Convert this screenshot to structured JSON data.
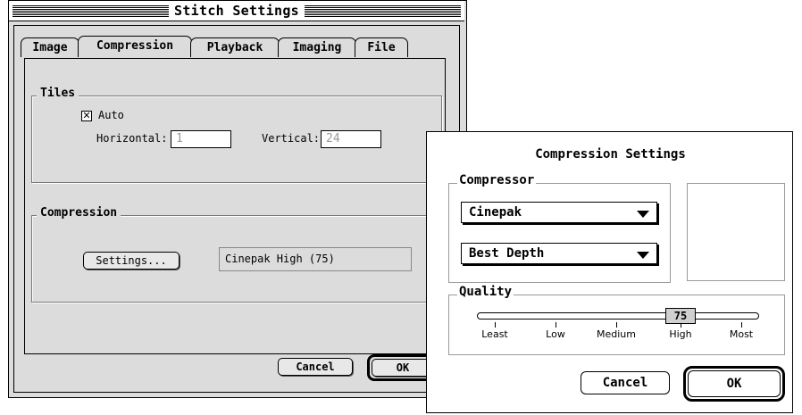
{
  "stitch": {
    "title": "Stitch Settings",
    "tabs": [
      {
        "label": "Image"
      },
      {
        "label": "Compression"
      },
      {
        "label": "Playback"
      },
      {
        "label": "Imaging"
      },
      {
        "label": "File"
      }
    ],
    "active_tab": "Compression",
    "tiles": {
      "label": "Tiles",
      "auto_label": "Auto",
      "auto_checked": true,
      "horizontal_label": "Horizontal:",
      "horizontal_value": "1",
      "vertical_label": "Vertical:",
      "vertical_value": "24"
    },
    "compression": {
      "label": "Compression",
      "settings_button": "Settings...",
      "current_value": "Cinepak High (75)"
    },
    "cancel_label": "Cancel",
    "ok_label": "OK"
  },
  "compression_dialog": {
    "title": "Compression Settings",
    "compressor": {
      "label": "Compressor",
      "codec": "Cinepak",
      "depth": "Best Depth"
    },
    "quality": {
      "label": "Quality",
      "value": "75",
      "tick_labels": [
        "Least",
        "Low",
        "Medium",
        "High",
        "Most"
      ]
    },
    "cancel_label": "Cancel",
    "ok_label": "OK"
  }
}
